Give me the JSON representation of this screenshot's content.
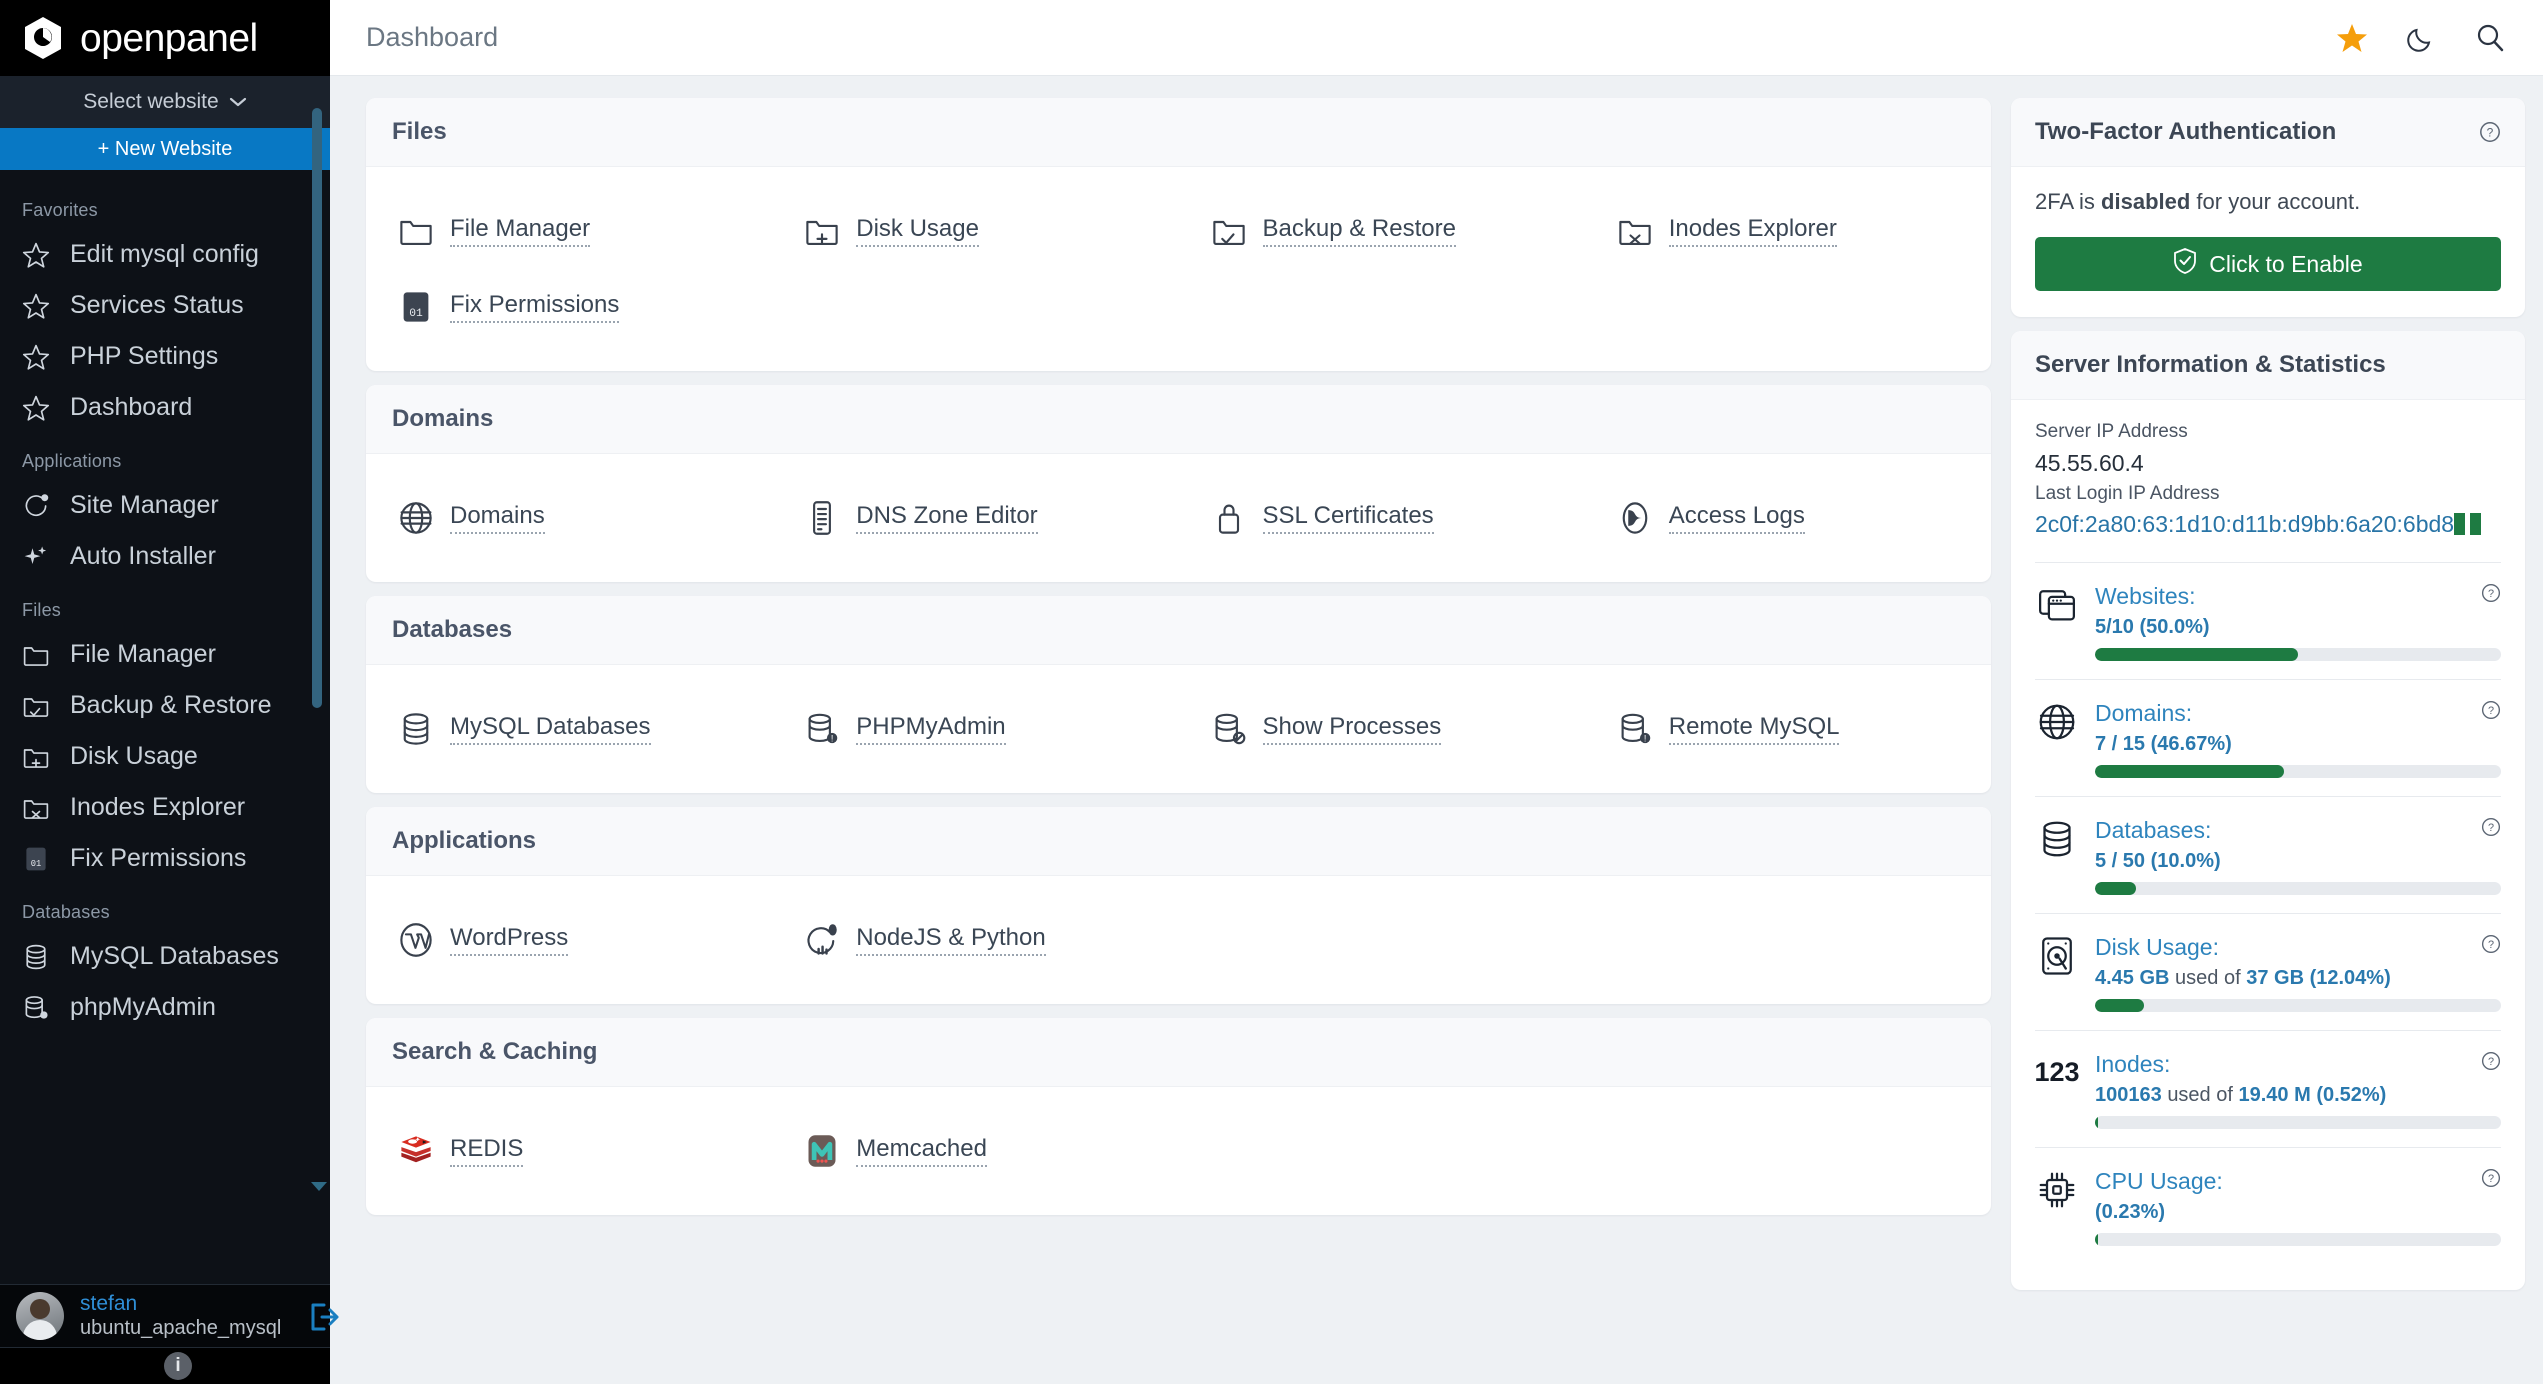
{
  "brand": {
    "name": "openpanel"
  },
  "sidebar": {
    "select_website": "Select website",
    "new_website": "+ New Website",
    "groups": [
      {
        "label": "Favorites",
        "items": [
          {
            "label": "Edit mysql config",
            "icon": "star-icon"
          },
          {
            "label": "Services Status",
            "icon": "star-icon"
          },
          {
            "label": "PHP Settings",
            "icon": "star-icon"
          },
          {
            "label": "Dashboard",
            "icon": "star-icon"
          }
        ]
      },
      {
        "label": "Applications",
        "items": [
          {
            "label": "Site Manager",
            "icon": "site-manager-icon"
          },
          {
            "label": "Auto Installer",
            "icon": "sparkles-icon"
          }
        ]
      },
      {
        "label": "Files",
        "items": [
          {
            "label": "File Manager",
            "icon": "folder-icon"
          },
          {
            "label": "Backup & Restore",
            "icon": "folder-check-icon"
          },
          {
            "label": "Disk Usage",
            "icon": "folder-plus-icon"
          },
          {
            "label": "Inodes Explorer",
            "icon": "folder-x-icon"
          },
          {
            "label": "Fix Permissions",
            "icon": "binary-icon"
          }
        ]
      },
      {
        "label": "Databases",
        "items": [
          {
            "label": "MySQL Databases",
            "icon": "database-icon"
          },
          {
            "label": "phpMyAdmin",
            "icon": "database-gear-icon"
          }
        ]
      }
    ],
    "user": {
      "name": "stefan",
      "subtitle": "ubuntu_apache_mysql",
      "info_badge": "i"
    }
  },
  "topbar": {
    "title": "Dashboard",
    "icons": [
      "star-icon",
      "moon-icon",
      "search-icon"
    ]
  },
  "sections": [
    {
      "title": "Files",
      "tiles": [
        {
          "label": "File Manager",
          "icon": "folder-icon"
        },
        {
          "label": "Disk Usage",
          "icon": "folder-plus-icon"
        },
        {
          "label": "Backup & Restore",
          "icon": "folder-check-icon"
        },
        {
          "label": "Inodes Explorer",
          "icon": "folder-x-icon"
        },
        {
          "label": "Fix Permissions",
          "icon": "binary-icon"
        }
      ]
    },
    {
      "title": "Domains",
      "tiles": [
        {
          "label": "Domains",
          "icon": "globe-icon"
        },
        {
          "label": "DNS Zone Editor",
          "icon": "dns-server-icon"
        },
        {
          "label": "SSL Certificates",
          "icon": "lock-icon"
        },
        {
          "label": "Access Logs",
          "icon": "access-logs-icon"
        }
      ]
    },
    {
      "title": "Databases",
      "tiles": [
        {
          "label": "MySQL Databases",
          "icon": "database-icon"
        },
        {
          "label": "PHPMyAdmin",
          "icon": "database-info-icon"
        },
        {
          "label": "Show Processes",
          "icon": "database-block-icon"
        },
        {
          "label": "Remote MySQL",
          "icon": "database-info-icon"
        }
      ]
    },
    {
      "title": "Applications",
      "tiles": [
        {
          "label": "WordPress",
          "icon": "wordpress-icon"
        },
        {
          "label": "NodeJS & Python",
          "icon": "nodejs-icon"
        }
      ]
    },
    {
      "title": "Search & Caching",
      "tiles": [
        {
          "label": "REDIS",
          "icon": "redis-icon"
        },
        {
          "label": "Memcached",
          "icon": "memcached-icon"
        }
      ]
    }
  ],
  "two_factor": {
    "title": "Two-Factor Authentication",
    "status_prefix": "2FA is ",
    "status_strong": "disabled",
    "status_suffix": " for your account.",
    "button": "Click to Enable"
  },
  "server_info": {
    "title": "Server Information & Statistics",
    "server_ip_label": "Server IP Address",
    "server_ip": "45.55.60.4",
    "last_login_label": "Last Login IP Address",
    "last_login_ip": "2c0f:2a80:63:1d10:d11b:d9bb:6a20:6bd8"
  },
  "stats": [
    {
      "name": "Websites:",
      "icon": "websites-icon",
      "used": "5/10",
      "unit": "",
      "of": "",
      "percent_text": "(50.0%)",
      "value_html": "<b>5/10</b> <b>(50.0%)</b>",
      "percent": 50
    },
    {
      "name": "Domains:",
      "icon": "globe-icon",
      "value_html": "<b>7 / 15</b> <b>(46.67%)</b>",
      "percent": 46.67
    },
    {
      "name": "Databases:",
      "icon": "database-icon",
      "value_html": "<b>5 / 50</b> <b>(10.0%)</b>",
      "percent": 10
    },
    {
      "name": "Disk Usage:",
      "icon": "disk-icon",
      "value_html": "<b>4.45 GB</b> <span class='muted'>used of</span> <b>37 GB</b> <b>(12.04%)</b>",
      "percent": 12.04
    },
    {
      "name": "Inodes:",
      "icon": "123-icon",
      "icon_text": "123",
      "value_html": "<b>100163</b> <span class='muted'>used of</span> <b>19.40 M</b> <b>(0.52%)</b>",
      "percent": 0.52
    },
    {
      "name": "CPU Usage:",
      "icon": "cpu-icon",
      "value_html": "<b>(0.23%)</b>",
      "percent": 0.23
    }
  ],
  "colors": {
    "accent_blue": "#0878c4",
    "link_blue": "#2e84bd",
    "green": "#1e7b42",
    "sidebar_bg": "#0d1117",
    "star_gold": "#f59e0b"
  }
}
